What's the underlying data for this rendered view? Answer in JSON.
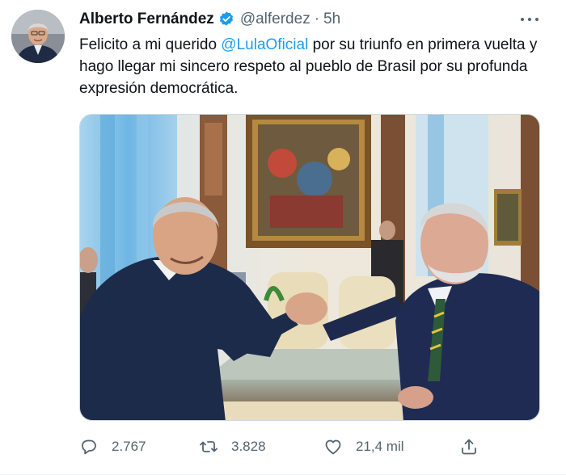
{
  "tweet": {
    "author": {
      "display_name": "Alberto Fernández",
      "handle": "@alferdez",
      "verified": true,
      "avatar_icon": "avatar-photo"
    },
    "separator": "·",
    "time": "5h",
    "text": {
      "before": "Felicito a mi querido ",
      "mention": "@LulaOficial",
      "after": " por su triunfo en primera vuelta y hago llegar mi sincero respeto al pueblo de Brasil por su profunda expresión democrática."
    },
    "media": {
      "type": "photo",
      "icon": "photo-handshake"
    },
    "actions": {
      "reply_count": "2.767",
      "retweet_count": "3.828",
      "like_count": "21,4 mil",
      "reply_icon": "reply-icon",
      "retweet_icon": "retweet-icon",
      "like_icon": "heart-icon",
      "share_icon": "share-icon"
    },
    "colors": {
      "accent": "#1d9bf0",
      "muted": "#536471",
      "text": "#0f1419"
    }
  }
}
